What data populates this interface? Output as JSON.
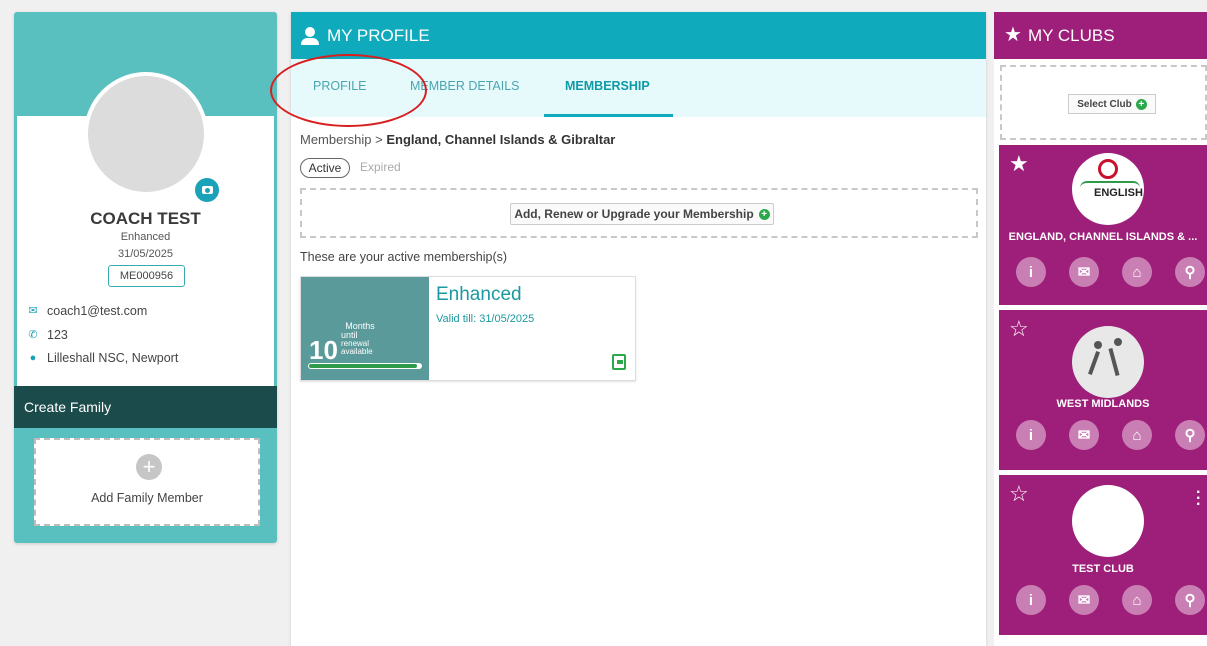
{
  "left": {
    "name": "COACH TEST",
    "level": "Enhanced",
    "date": "31/05/2025",
    "member_id": "ME000956",
    "email": "coach1@test.com",
    "phone": "123",
    "location": "Lilleshall NSC, Newport",
    "create_family": "Create Family",
    "add_family_member": "Add Family Member"
  },
  "profile": {
    "header": "MY PROFILE",
    "tabs": [
      "PROFILE",
      "MEMBER DETAILS",
      "MEMBERSHIP"
    ],
    "active_tab": "MEMBERSHIP",
    "breadcrumb_root": "Membership",
    "breadcrumb_sep": ">",
    "breadcrumb_current": "England, Channel Islands & Gibraltar",
    "filter_active": "Active",
    "filter_expired": "Expired",
    "add_renew": "Add, Renew or Upgrade your Membership",
    "active_text": "These are your active membership(s)",
    "card": {
      "title": "Enhanced",
      "valid": "Valid till: 31/05/2025",
      "months_label": "Months",
      "until": "until",
      "months_number": "10",
      "renewal": "renewal",
      "available": "available",
      "progress": 0.95
    }
  },
  "clubs": {
    "header": "MY CLUBS",
    "select_club": "Select Club",
    "items": [
      {
        "name": "ENGLAND, CHANNEL ISLANDS & ...",
        "logo_text": "ENGLISH",
        "starred": true
      },
      {
        "name": "WEST MIDLANDS",
        "logo_text": "",
        "starred": false
      },
      {
        "name": "TEST CLUB",
        "logo_text": "",
        "starred": false
      }
    ]
  },
  "icons": [
    "camera-icon",
    "email-icon",
    "phone-icon",
    "location-icon",
    "plus-icon",
    "user-icon",
    "star-icon",
    "info-icon",
    "mail-icon",
    "home-icon",
    "map-icon"
  ]
}
